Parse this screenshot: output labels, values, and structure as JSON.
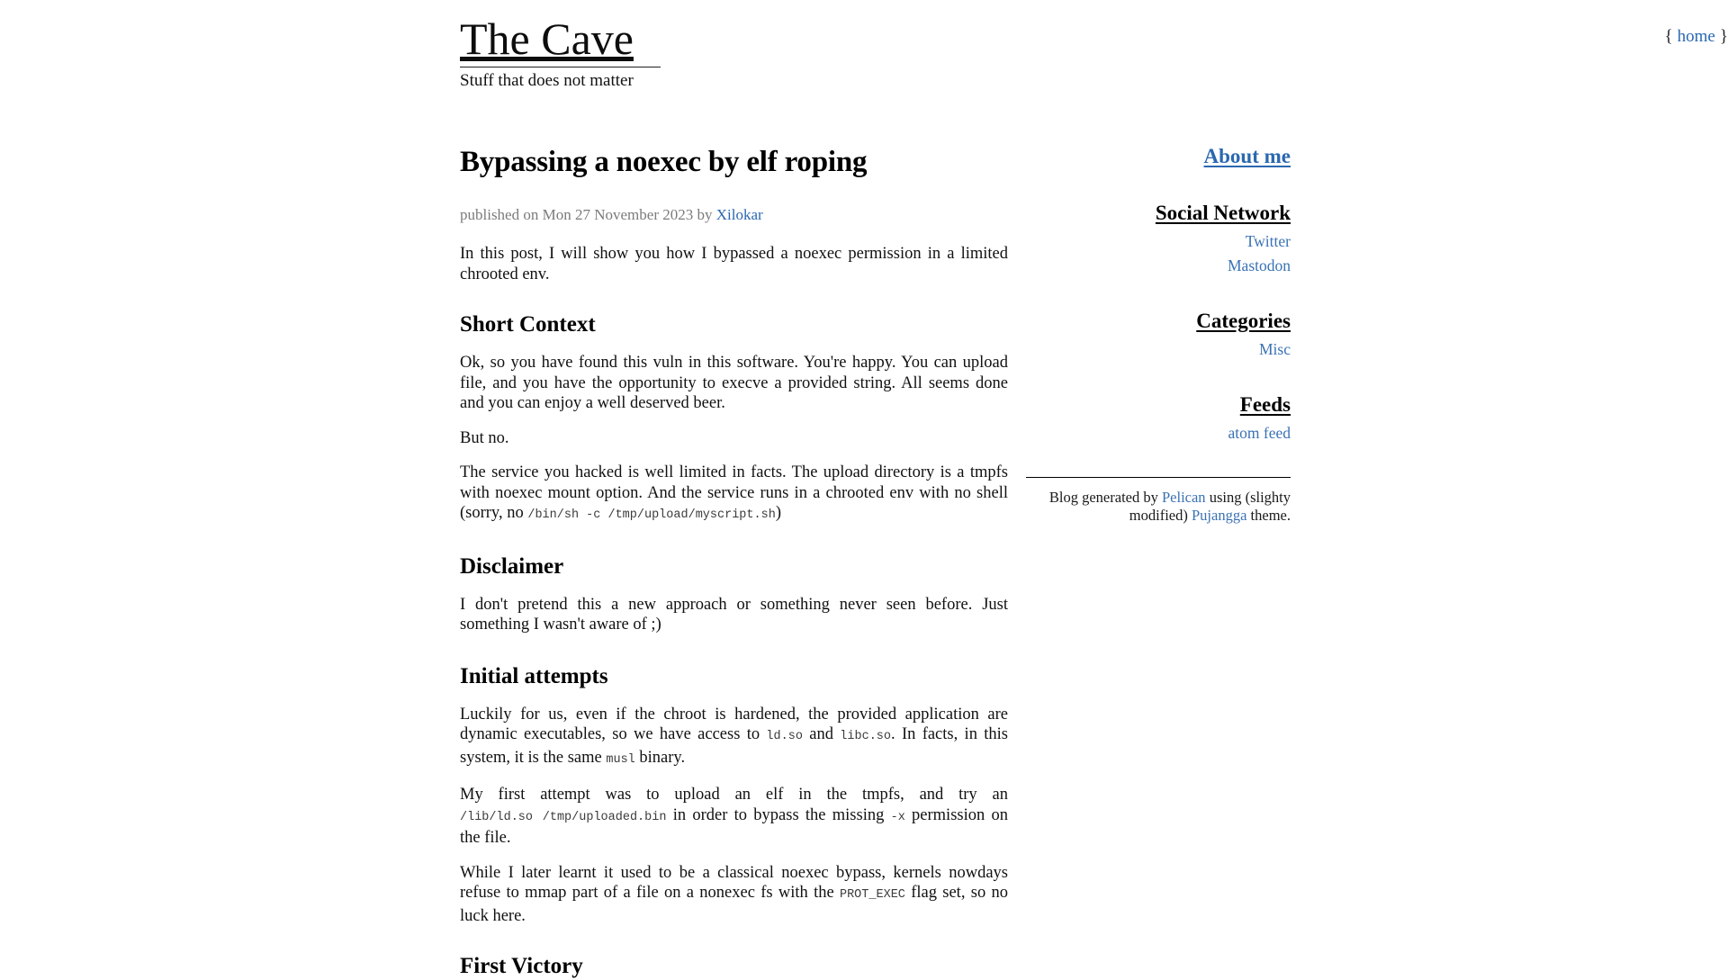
{
  "site": {
    "title": "The Cave",
    "tagline": "Stuff that does not matter",
    "nav": {
      "open_brace": "{",
      "close_brace": "}",
      "home_label": "home"
    }
  },
  "post": {
    "title": "Bypassing a noexec by elf roping",
    "meta_prefix": "published on Mon 27 November 2023 by ",
    "author": "Xilokar",
    "intro": "In this post, I will show you how I bypassed a noexec permission in a limited chrooted env.",
    "sections": [
      {
        "heading": "Short Context",
        "paragraphs": [
          "Ok, so you have found this vuln in this software. You're happy. You can upload file, and you have the opportunity to execve a provided string. All seems done and you can enjoy a well deserved beer.",
          "But no."
        ],
        "rich_paragraph": {
          "part1": "The service you hacked is well limited in facts. The upload directory is a tmpfs with noexec mount option. And the service runs in a chrooted env with no shell (sorry, no ",
          "code1": "/bin/sh -c /tmp/upload/myscript.sh",
          "part2": ")"
        }
      },
      {
        "heading": "Disclaimer",
        "paragraphs": [
          "I don't pretend this a new approach or something never seen before. Just something I wasn't aware of ;)"
        ]
      },
      {
        "heading": "Initial attempts",
        "p1": {
          "part1": "Luckily for us, even if the chroot is hardened, the provided application are dynamic executables, so we have access to ",
          "code1": "ld.so",
          "part2": " and ",
          "code2": "libc.so",
          "part3": ". In facts, in this system, it is the same ",
          "code3": "musl",
          "part4": " binary."
        },
        "p2": {
          "part1": "My first attempt was to upload an elf in the tmpfs, and try an ",
          "code1": "/lib/ld.so /tmp/uploaded.bin",
          "part2": " in order to bypass the missing ",
          "code2": "-x",
          "part3": " permission on the file."
        },
        "p3": {
          "part1": "While I later learnt it used to be a classical noexec bypass, kernels nowdays refuse to mmap part of a file on a nonexec fs with the ",
          "code1": "PROT_EXEC",
          "part2": " flag set, so no luck here."
        }
      },
      {
        "heading": "First Victory"
      }
    ]
  },
  "sidebar": {
    "about": {
      "label": "About me"
    },
    "social": {
      "heading": "Social Network",
      "links": [
        {
          "label": "Twitter"
        },
        {
          "label": "Mastodon"
        }
      ]
    },
    "categories": {
      "heading": "Categories",
      "links": [
        {
          "label": "Misc"
        }
      ]
    },
    "feeds": {
      "heading": "Feeds",
      "links": [
        {
          "label": "atom feed"
        }
      ]
    },
    "credit": {
      "part1": "Blog generated by ",
      "link1": "Pelican",
      "part2": " using (slighty modified) ",
      "link2": "Pujangga",
      "part3": " theme."
    }
  },
  "colors": {
    "link": "#2a68b0",
    "sidebar_link": "#3a72b5",
    "meta": "#7b7b7b",
    "text": "#111111",
    "code": "#3b3b3b",
    "background": "#ffffff"
  }
}
